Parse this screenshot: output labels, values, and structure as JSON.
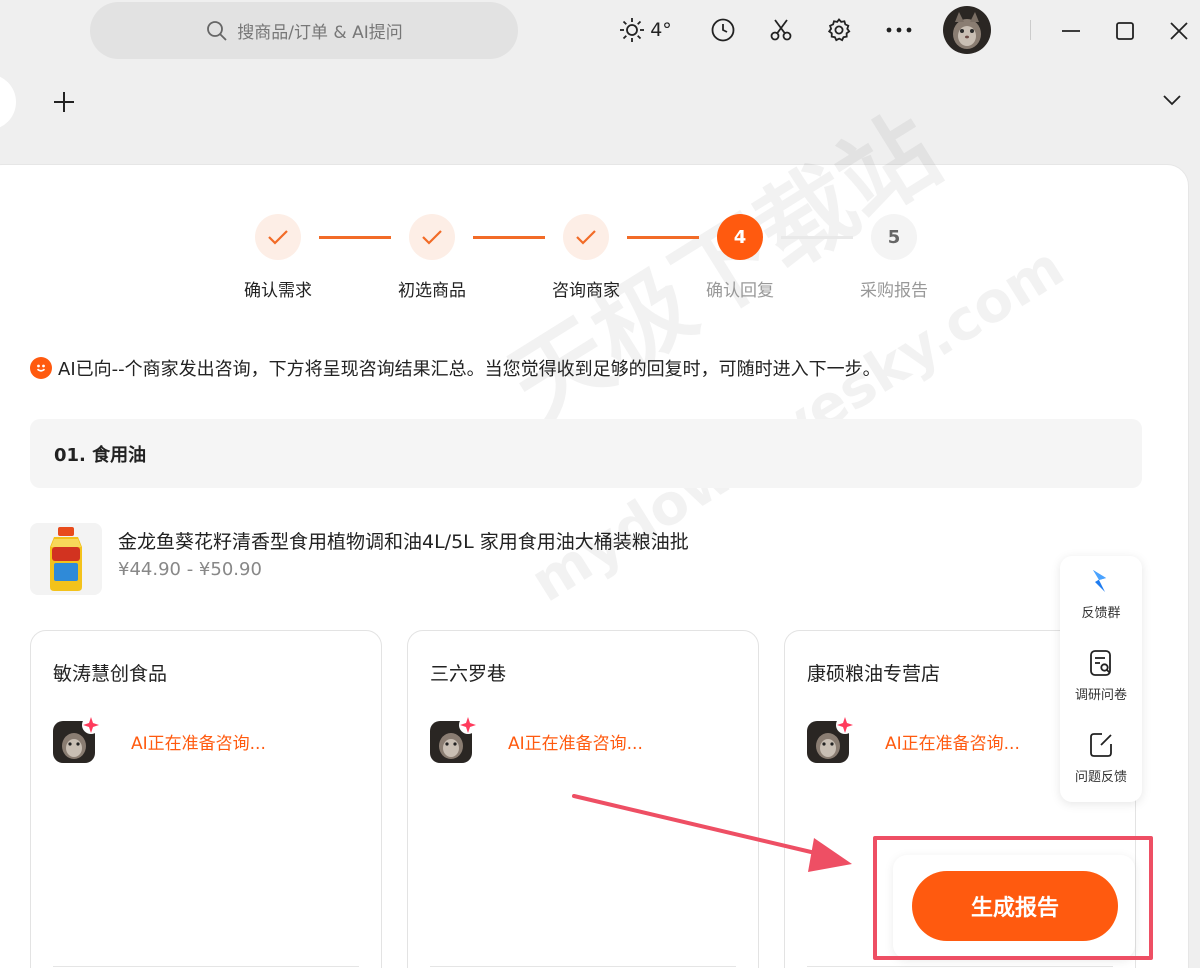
{
  "titlebar": {
    "search_placeholder": "搜商品/订单 & AI提问",
    "weather_temp": "4°",
    "icons": [
      "sun-icon",
      "clock-icon",
      "scissors-icon",
      "gear-icon",
      "more-icon",
      "avatar",
      "minimize-icon",
      "maximize-icon",
      "close-icon"
    ]
  },
  "steps": [
    {
      "label": "确认需求",
      "status": "done"
    },
    {
      "label": "初选商品",
      "status": "done"
    },
    {
      "label": "咨询商家",
      "status": "done"
    },
    {
      "label": "确认回复",
      "number": "4",
      "status": "active"
    },
    {
      "label": "采购报告",
      "number": "5",
      "status": "todo"
    }
  ],
  "notice": "AI已向--个商家发出咨询，下方将呈现咨询结果汇总。当您觉得收到足够的回复时，可随时进入下一步。",
  "category": "01. 食用油",
  "product": {
    "title": "金龙鱼葵花籽清香型食用植物调和油4L/5L 家用食用油大桶装粮油批",
    "price": "¥44.90 - ¥50.90"
  },
  "merchants": [
    {
      "name": "敏涛慧创食品",
      "status": "AI正在准备咨询..."
    },
    {
      "name": "三六罗巷",
      "status": "AI正在准备咨询..."
    },
    {
      "name": "康硕粮油专营店",
      "status": "AI正在准备咨询..."
    }
  ],
  "float_bar": [
    {
      "label": "反馈群",
      "icon": "feedback-group-icon"
    },
    {
      "label": "调研问卷",
      "icon": "survey-icon"
    },
    {
      "label": "问题反馈",
      "icon": "issue-feedback-icon"
    }
  ],
  "generate_button": "生成报告",
  "watermark": "天极下载站",
  "watermark_url": "mydown.yesky.com",
  "colors": {
    "accent": "#ff5a0f",
    "annotation": "#ee4f64"
  }
}
